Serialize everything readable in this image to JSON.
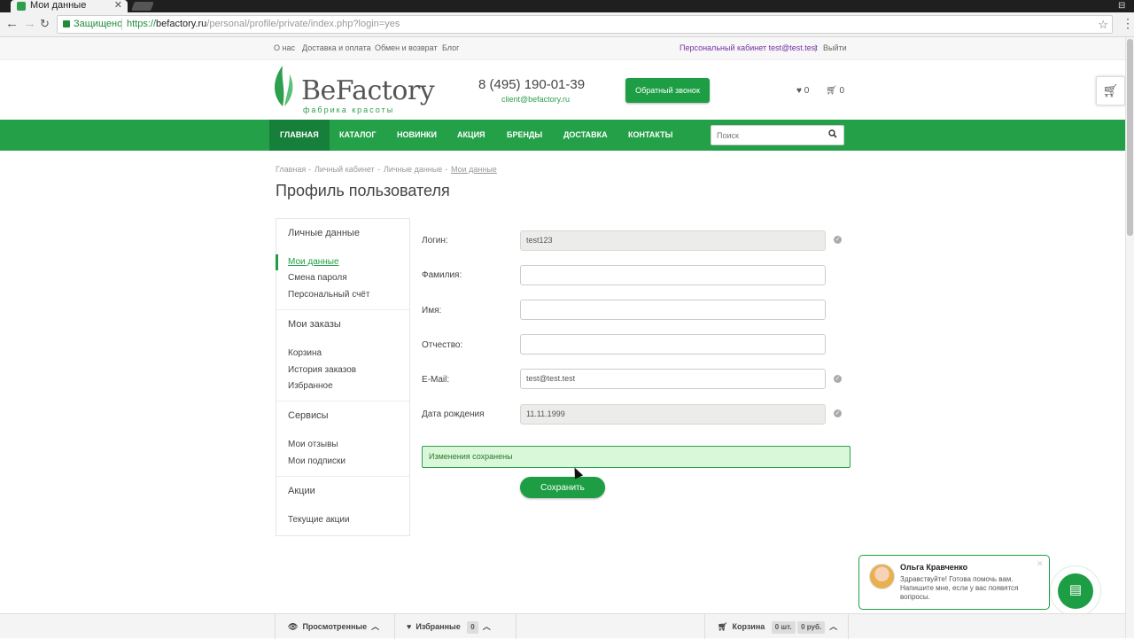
{
  "browser": {
    "tab_title": "Мои данные",
    "tab_close": "✕",
    "secure_label": "Защищено",
    "url_scheme": "https://",
    "url_domain": "befactory.ru",
    "url_path": "/personal/profile/private/index.php?login=yes"
  },
  "toplinks": {
    "about": "О нас",
    "delivery": "Доставка и оплата",
    "exchange": "Обмен и возврат",
    "blog": "Блог",
    "personal": "Персональный кабинет test@test.test",
    "logout": "Выйти"
  },
  "header": {
    "logo_text": "BeFactory",
    "logo_sub": "фабрика красоты",
    "phone": "8 (495) 190-01-39",
    "email": "client@befactory.ru",
    "callback_label": "Обратный звонок",
    "wishlist_count": "0",
    "cart_count": "0"
  },
  "nav": {
    "items": [
      "ГЛАВНАЯ",
      "КАТАЛОГ",
      "НОВИНКИ",
      "АКЦИЯ",
      "БРЕНДЫ",
      "ДОСТАВКА",
      "КОНТАКТЫ"
    ],
    "search_placeholder": "Поиск"
  },
  "breadcrumb": [
    "Главная",
    "Личный кабинет",
    "Личные данные",
    "Мои данные"
  ],
  "breadcrumb_sep": "-",
  "page_title": "Профиль пользователя",
  "sidebar": {
    "sections": [
      {
        "title": "Личные данные",
        "items": [
          "Мои данные",
          "Смена пароля",
          "Персональный счёт"
        ]
      },
      {
        "title": "Мои заказы",
        "items": [
          "Корзина",
          "История заказов",
          "Избранное"
        ]
      },
      {
        "title": "Сервисы",
        "items": [
          "Мои отзывы",
          "Мои подписки"
        ]
      },
      {
        "title": "Акции",
        "items": [
          "Текущие акции"
        ]
      }
    ]
  },
  "form": {
    "fields": [
      {
        "label": "Логин:",
        "value": "test123"
      },
      {
        "label": "Фамилия:",
        "value": ""
      },
      {
        "label": "Имя:",
        "value": ""
      },
      {
        "label": "Отчество:",
        "value": ""
      },
      {
        "label": "E-Mail:",
        "value": "test@test.test"
      },
      {
        "label": "Дата рождения",
        "value": "11.11.1999"
      }
    ],
    "success_message": "Изменения сохранены",
    "save_label": "Сохранить"
  },
  "chat": {
    "name": "Ольга Кравченко",
    "message": "Здравствуйте! Готова помочь вам. Напишите мне, если у вас появятся вопросы."
  },
  "bottom_bar": {
    "viewed": "Просмотренные",
    "favorites": "Избранные",
    "favorites_count": "0",
    "cart": "Корзина",
    "cart_qty": "0 шт.",
    "cart_sum": "0 руб."
  },
  "colors": {
    "brand_green": "#24a148",
    "nav_active": "#16803a",
    "personal_link": "#7a2fa8"
  }
}
